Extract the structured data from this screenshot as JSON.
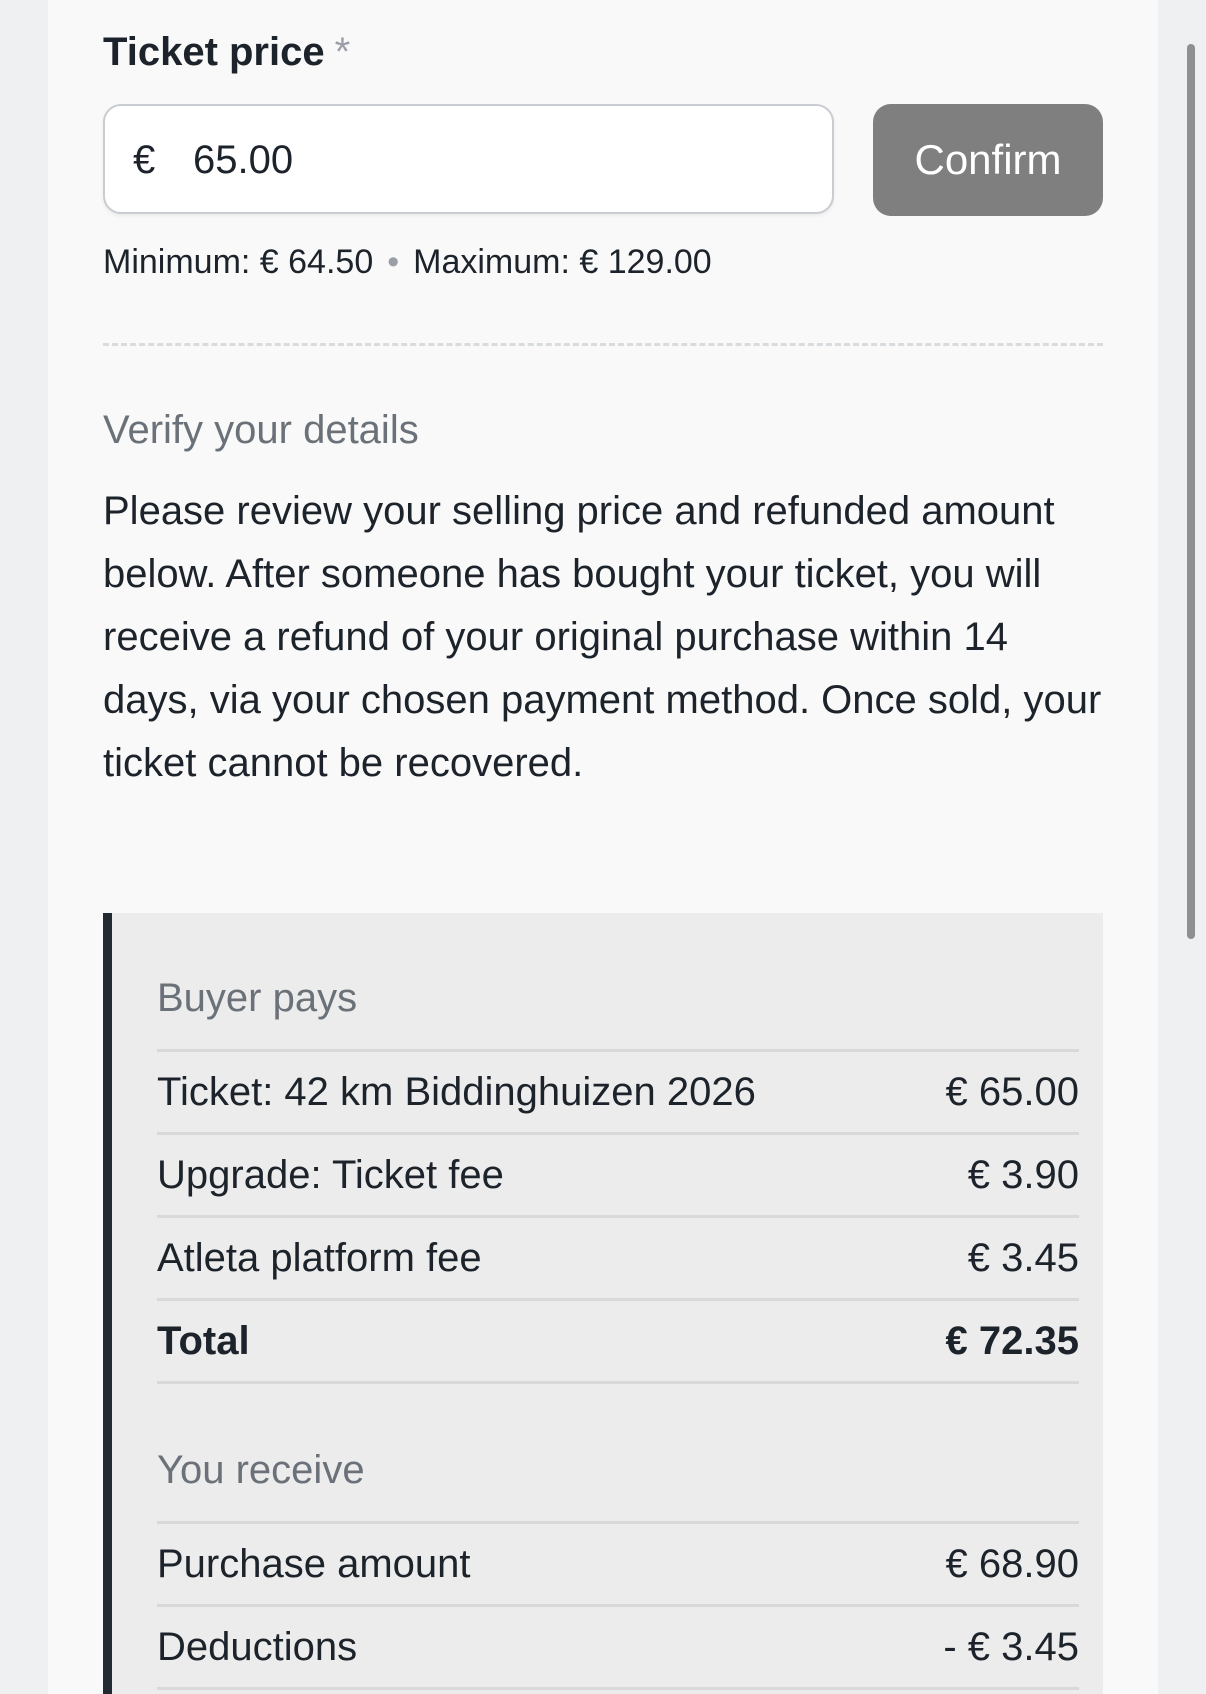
{
  "price_field": {
    "label": "Ticket price",
    "required_marker": "*",
    "currency_symbol": "€",
    "value": "65.00",
    "confirm_label": "Confirm",
    "minimum_text": "Minimum: € 64.50",
    "separator": "•",
    "maximum_text": "Maximum: € 129.00"
  },
  "verify": {
    "heading": "Verify your details",
    "body": "Please review your selling price and refunded amount below. After someone has bought your ticket, you will receive a refund of your original purchase within 14 days, via your chosen payment method. Once sold, your ticket cannot be recovered."
  },
  "buyer_pays": {
    "title": "Buyer pays",
    "rows": [
      {
        "label": "Ticket: 42 km Biddinghuizen 2026",
        "amount": "€ 65.00"
      },
      {
        "label": "Upgrade: Ticket fee",
        "amount": "€ 3.90"
      },
      {
        "label": "Atleta platform fee",
        "amount": "€ 3.45"
      }
    ],
    "total": {
      "label": "Total",
      "amount": "€ 72.35"
    }
  },
  "you_receive": {
    "title": "You receive",
    "rows": [
      {
        "label": "Purchase amount",
        "amount": "€ 68.90"
      },
      {
        "label": "Deductions",
        "amount": "- € 3.45"
      }
    ]
  },
  "colors": {
    "confirm_button_bg": "#7f7f7f",
    "summary_bg": "#ececec",
    "summary_accent_bar": "#242a31"
  }
}
